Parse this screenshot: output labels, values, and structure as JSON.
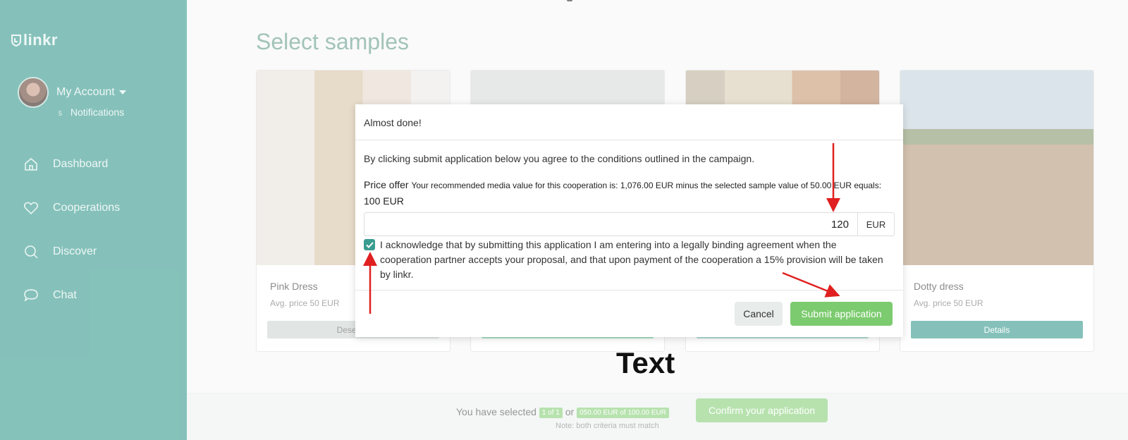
{
  "sidebar": {
    "logo": "linkr",
    "account_label": "My Account",
    "notifications_count": "5",
    "notifications_label": "Notifications",
    "nav": [
      {
        "label": "Dashboard",
        "icon": "home-icon"
      },
      {
        "label": "Cooperations",
        "icon": "heart-icon"
      },
      {
        "label": "Discover",
        "icon": "search-icon"
      },
      {
        "label": "Chat",
        "icon": "chat-bubble-icon"
      }
    ]
  },
  "main": {
    "title": "Select samples",
    "cards": [
      {
        "name": "Pink Dress",
        "price": "Avg. price 50 EUR",
        "button": "Deselect"
      },
      {
        "name": "",
        "price": "",
        "button": ""
      },
      {
        "name": "",
        "price": "",
        "button": ""
      },
      {
        "name": "Dotty dress",
        "price": "Avg. price 50 EUR",
        "button": "Details"
      }
    ]
  },
  "bottom_bar": {
    "text_prefix": "You have selected",
    "count_pill": "1 of 1",
    "or": "or",
    "value_pill": "050.00 EUR of 100.00 EUR",
    "note": "Note: both criteria must match",
    "confirm_button": "Confirm your application"
  },
  "modal": {
    "title": "Almost done!",
    "description": "By clicking submit application below you agree to the conditions outlined in the campaign.",
    "price_offer_label": "Price offer",
    "price_offer_hint": "Your recommended media value for this cooperation is: 1,076.00 EUR minus the selected sample value of 50.00 EUR equals:",
    "recommended_value": "100 EUR",
    "offer_input_value": "120",
    "currency": "EUR",
    "checkbox_checked": true,
    "acknowledge_text": "I acknowledge that by submitting this application I am entering into a legally binding agreement when the cooperation partner accepts your proposal, and that upon payment of the cooperation a 15% provision will be taken by linkr.",
    "cancel_button": "Cancel",
    "submit_button": "Submit application"
  },
  "annotation_text": "Text",
  "colors": {
    "sidebar": "#3a9c90",
    "accent_green": "#7ccb6f",
    "annotation_red": "#e02020"
  }
}
